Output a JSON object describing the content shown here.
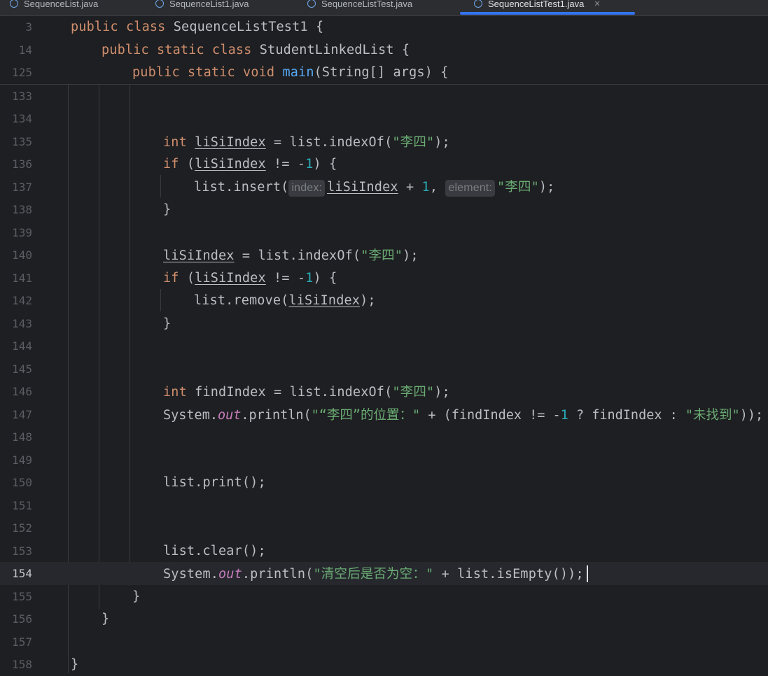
{
  "tabs": [
    {
      "label": "SequenceList.java"
    },
    {
      "label": "SequenceList1.java"
    },
    {
      "label": "SequenceListTest.java"
    },
    {
      "label": "SequenceListTest1.java"
    }
  ],
  "sticky": [
    {
      "num": "3"
    },
    {
      "num": "14"
    },
    {
      "num": "125"
    }
  ],
  "lines": [
    {
      "num": "133"
    },
    {
      "num": "134"
    },
    {
      "num": "135"
    },
    {
      "num": "136"
    },
    {
      "num": "137"
    },
    {
      "num": "138"
    },
    {
      "num": "139"
    },
    {
      "num": "140"
    },
    {
      "num": "141"
    },
    {
      "num": "142"
    },
    {
      "num": "143"
    },
    {
      "num": "144"
    },
    {
      "num": "145"
    },
    {
      "num": "146"
    },
    {
      "num": "147"
    },
    {
      "num": "148"
    },
    {
      "num": "149"
    },
    {
      "num": "150"
    },
    {
      "num": "151"
    },
    {
      "num": "152"
    },
    {
      "num": "153"
    },
    {
      "num": "154"
    },
    {
      "num": "155"
    },
    {
      "num": "156"
    },
    {
      "num": "157"
    },
    {
      "num": "158"
    }
  ],
  "code": {
    "s3_a": "public class",
    "s3_b": " SequenceListTest1 {",
    "s14_a": "public static class",
    "s14_b": " StudentLinkedList {",
    "s125_a": "public static void",
    "s125_fn": "main",
    "s125_b": "(String[] args) {",
    "kw_int": "int",
    "kw_if": "if",
    "var_lisi": "liSiIndex",
    "eq_indexof": " = list.indexOf(",
    "str_lisi": "\"李四\"",
    "close_semi": ");",
    "if_open": " (",
    "neq": " != -",
    "one": "1",
    "if_close": ") {",
    "insert_call": "list.insert(",
    "hint_index": "index:",
    "plus1": " + ",
    "comma": ", ",
    "hint_element": "element:",
    "brace_close": "}",
    "remove_call": "list.remove(",
    "find_decl": " findIndex = list.indexOf(",
    "sys": "System.",
    "out": "out",
    "println": ".println(",
    "str_found": "\"“李四”的位置：\"",
    "find_expr_a": " + (findIndex != -",
    "find_expr_b": " ? findIndex : ",
    "str_notfound": "\"未找到\"",
    "find_expr_c": "));",
    "print_call": "list.print();",
    "clear_call": "list.clear();",
    "str_empty": "\"清空后是否为空：\"",
    "empty_expr": " + list.isEmpty());"
  }
}
